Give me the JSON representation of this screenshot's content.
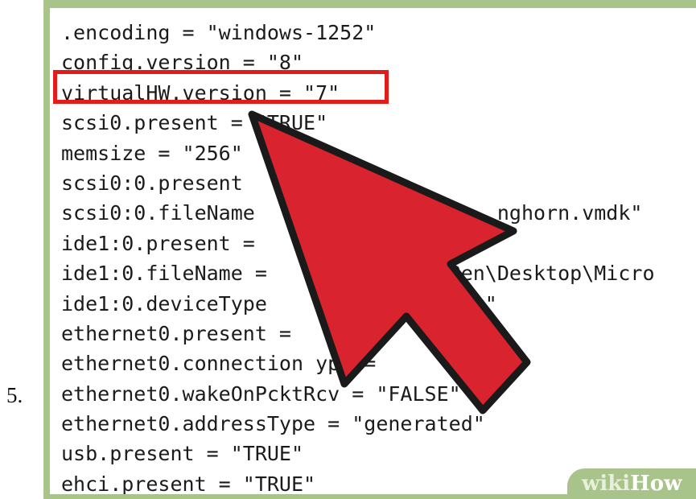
{
  "step": {
    "number": "5."
  },
  "code": {
    "lines": [
      ".encoding = \"windows-1252\"",
      "config.version = \"8\"",
      "virtualHW.version = \"7\"",
      "scsi0.present = \"TRUE\"",
      "memsize = \"256\"",
      "scsi0:0.present",
      "scsi0:0.fileName                    nghorn.vmdk\"",
      "ide1:0.present =",
      "ide1:0.fileName =              \\Ben\\Desktop\\Micro",
      "ide1:0.deviceType               age\"",
      "ethernet0.present =    RUE",
      "ethernet0.connection ype =",
      "ethernet0.wakeOnPcktRcv = \"FALSE\"",
      "ethernet0.addressType = \"generated\"",
      "usb.present = \"TRUE\"",
      "ehci.present = \"TRUE\""
    ]
  },
  "highlight": {
    "line": "virtualHW.version = \"7\"",
    "color": "#e21b1b"
  },
  "arrow": {
    "icon": "large-pointer-arrow-icon",
    "fill": "#d9232f",
    "outline": "#1a1a1a"
  },
  "watermark": {
    "wiki": "wiki",
    "how": "How"
  },
  "colors": {
    "frame": "#a9c48a",
    "text": "#1b1b1b"
  }
}
